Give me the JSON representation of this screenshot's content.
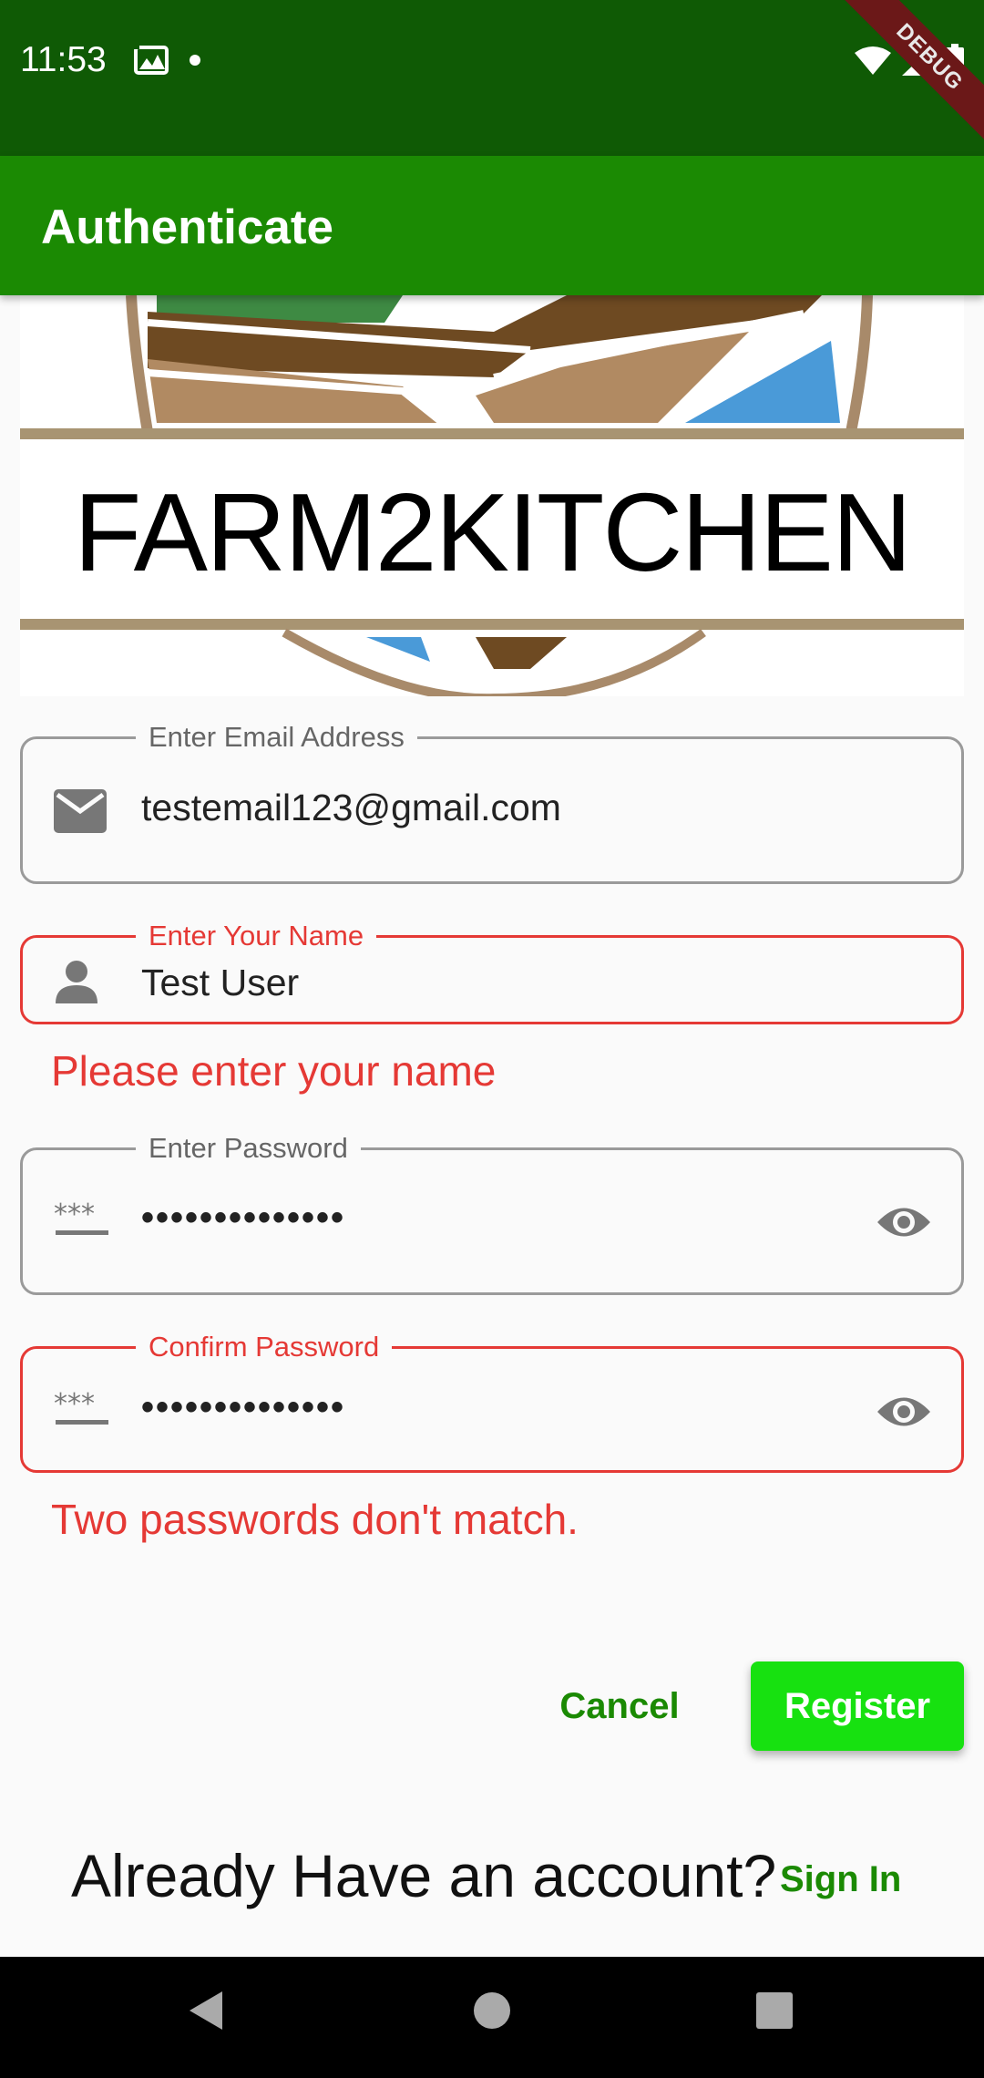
{
  "status_bar": {
    "time": "11:53",
    "debug_label": "DEBUG"
  },
  "app_bar": {
    "title": "Authenticate"
  },
  "logo": {
    "text": "FARM2KITCHEN"
  },
  "form": {
    "email": {
      "label": "Enter Email Address",
      "value": "testemail123@gmail.com",
      "icon": "email-icon"
    },
    "name": {
      "label": "Enter Your Name",
      "value": "Test User",
      "icon": "person-icon",
      "error": "Please enter your name"
    },
    "password": {
      "label": "Enter Password",
      "value": "••••••••••••••",
      "icon": "password-icon"
    },
    "confirm_password": {
      "label": "Confirm Password",
      "value": "••••••••••••••",
      "icon": "password-icon",
      "error": "Two passwords don't match."
    }
  },
  "actions": {
    "cancel": "Cancel",
    "register": "Register"
  },
  "footer": {
    "prompt": "Already Have an account?",
    "sign_in": "Sign In"
  },
  "colors": {
    "status_bar": "#0f5a05",
    "app_bar": "#1b8a03",
    "accent_green": "#1b8a03",
    "register_button": "#17e110",
    "error": "#e53935"
  },
  "nav_bar": {
    "icons": [
      "back-icon",
      "home-icon",
      "recents-icon"
    ]
  }
}
